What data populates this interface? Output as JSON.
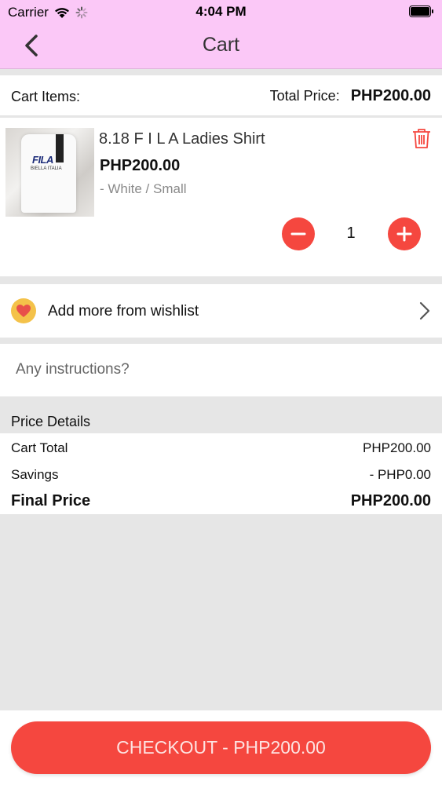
{
  "status_bar": {
    "carrier": "Carrier",
    "time": "4:04 PM"
  },
  "nav": {
    "title": "Cart",
    "back_icon": "chevron-left-icon"
  },
  "summary": {
    "items_label": "Cart Items:",
    "total_label": "Total Price:",
    "total_value": "PHP200.00"
  },
  "product": {
    "image_text": "FILA",
    "image_subtext": "BIELLA ITALIA",
    "name": "8.18 F I L A Ladies Shirt",
    "price": "PHP200.00",
    "variant": "- White / Small",
    "quantity": "1",
    "delete_icon": "trash-icon"
  },
  "wishlist": {
    "label": "Add more from wishlist",
    "icon": "heart-icon"
  },
  "instructions": {
    "placeholder": "Any instructions?"
  },
  "price_details": {
    "header": "Price Details",
    "rows": [
      {
        "label": "Cart Total",
        "value": "PHP200.00"
      },
      {
        "label": "Savings",
        "value": "- PHP0.00"
      },
      {
        "label": "Final Price",
        "value": "PHP200.00"
      }
    ]
  },
  "checkout": {
    "label": "CHECKOUT - PHP200.00"
  },
  "colors": {
    "header_bg": "#fbc8f7",
    "accent_red": "#f5473f",
    "wishlist_badge": "#f4c24a",
    "page_bg": "#e6e6e6"
  }
}
